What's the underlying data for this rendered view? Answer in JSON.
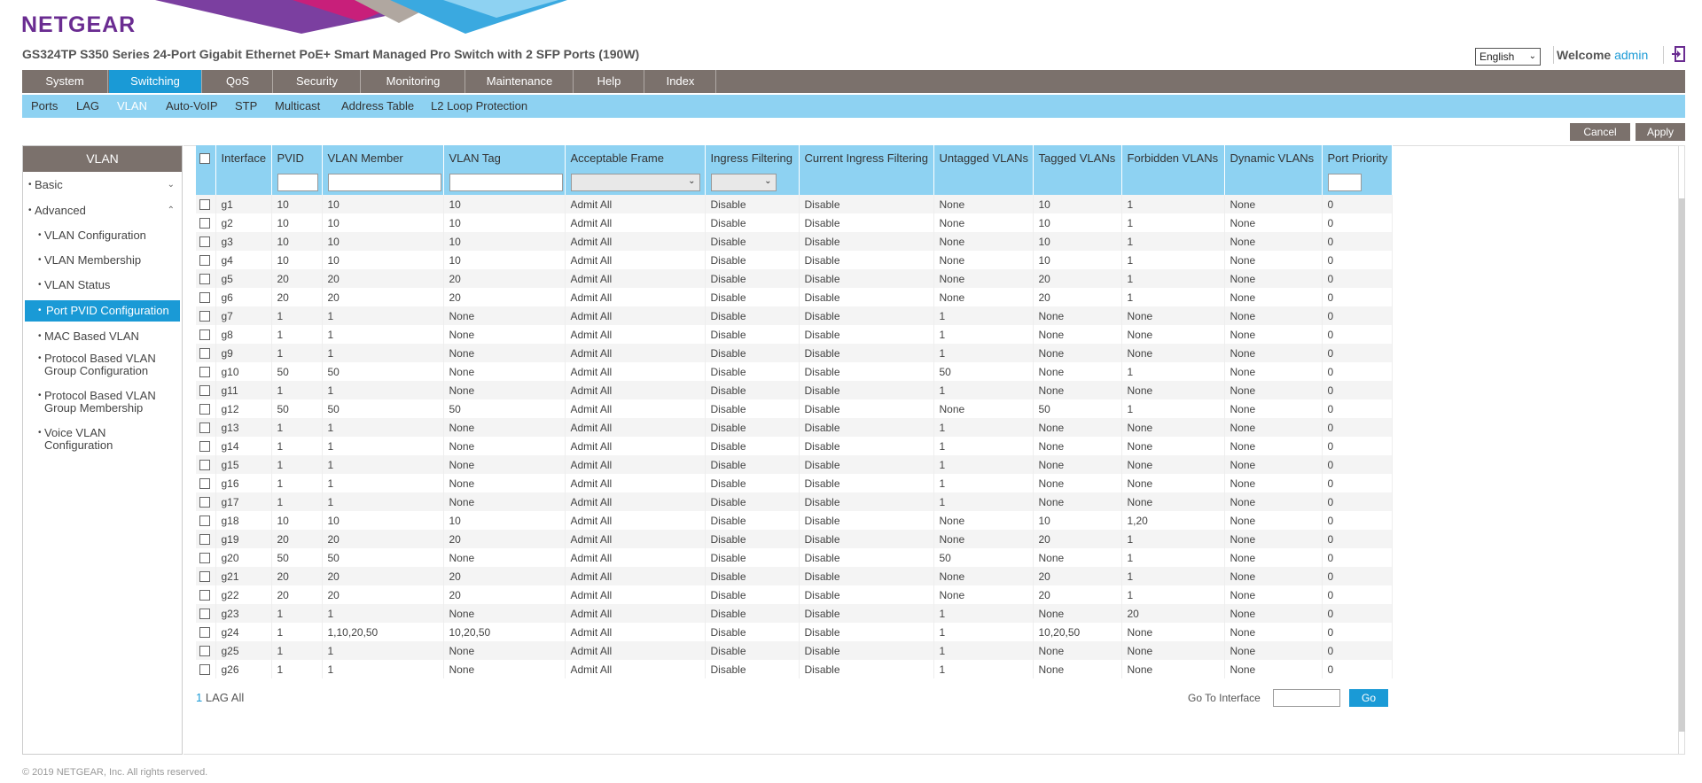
{
  "header": {
    "logo": "NETGEAR",
    "product_title": "GS324TP S350 Series 24-Port Gigabit Ethernet PoE+ Smart Managed Pro Switch with 2 SFP Ports (190W)",
    "language": "English",
    "welcome_label": "Welcome",
    "user": "admin"
  },
  "main_nav": [
    {
      "label": "System"
    },
    {
      "label": "Switching"
    },
    {
      "label": "QoS"
    },
    {
      "label": "Security"
    },
    {
      "label": "Monitoring"
    },
    {
      "label": "Maintenance"
    },
    {
      "label": "Help"
    },
    {
      "label": "Index"
    }
  ],
  "sub_nav": [
    {
      "label": "Ports"
    },
    {
      "label": "LAG"
    },
    {
      "label": "VLAN"
    },
    {
      "label": "Auto-VoIP"
    },
    {
      "label": "STP"
    },
    {
      "label": "Multicast"
    },
    {
      "label": "Address Table"
    },
    {
      "label": "L2 Loop Protection"
    }
  ],
  "actions": {
    "cancel": "Cancel",
    "apply": "Apply"
  },
  "sidebar": {
    "title": "VLAN",
    "items": [
      {
        "label": "Basic"
      },
      {
        "label": "Advanced"
      },
      {
        "label": "VLAN Configuration"
      },
      {
        "label": "VLAN Membership"
      },
      {
        "label": "VLAN Status"
      },
      {
        "label": "Port PVID Configuration"
      },
      {
        "label": "MAC Based VLAN"
      },
      {
        "label": "Protocol Based VLAN Group Configuration"
      },
      {
        "label": "Protocol Based VLAN Group Membership"
      },
      {
        "label": "Voice VLAN Configuration"
      }
    ]
  },
  "table": {
    "columns": [
      "Interface",
      "PVID",
      "VLAN Member",
      "VLAN Tag",
      "Acceptable Frame",
      "Ingress Filtering",
      "Current Ingress Filtering",
      "Untagged VLANs",
      "Tagged VLANs",
      "Forbidden VLANs",
      "Dynamic VLANs",
      "Port Priority"
    ],
    "rows": [
      [
        "g1",
        "10",
        "10",
        "10",
        "Admit All",
        "Disable",
        "Disable",
        "None",
        "10",
        "1",
        "None",
        "0"
      ],
      [
        "g2",
        "10",
        "10",
        "10",
        "Admit All",
        "Disable",
        "Disable",
        "None",
        "10",
        "1",
        "None",
        "0"
      ],
      [
        "g3",
        "10",
        "10",
        "10",
        "Admit All",
        "Disable",
        "Disable",
        "None",
        "10",
        "1",
        "None",
        "0"
      ],
      [
        "g4",
        "10",
        "10",
        "10",
        "Admit All",
        "Disable",
        "Disable",
        "None",
        "10",
        "1",
        "None",
        "0"
      ],
      [
        "g5",
        "20",
        "20",
        "20",
        "Admit All",
        "Disable",
        "Disable",
        "None",
        "20",
        "1",
        "None",
        "0"
      ],
      [
        "g6",
        "20",
        "20",
        "20",
        "Admit All",
        "Disable",
        "Disable",
        "None",
        "20",
        "1",
        "None",
        "0"
      ],
      [
        "g7",
        "1",
        "1",
        "None",
        "Admit All",
        "Disable",
        "Disable",
        "1",
        "None",
        "None",
        "None",
        "0"
      ],
      [
        "g8",
        "1",
        "1",
        "None",
        "Admit All",
        "Disable",
        "Disable",
        "1",
        "None",
        "None",
        "None",
        "0"
      ],
      [
        "g9",
        "1",
        "1",
        "None",
        "Admit All",
        "Disable",
        "Disable",
        "1",
        "None",
        "None",
        "None",
        "0"
      ],
      [
        "g10",
        "50",
        "50",
        "None",
        "Admit All",
        "Disable",
        "Disable",
        "50",
        "None",
        "1",
        "None",
        "0"
      ],
      [
        "g11",
        "1",
        "1",
        "None",
        "Admit All",
        "Disable",
        "Disable",
        "1",
        "None",
        "None",
        "None",
        "0"
      ],
      [
        "g12",
        "50",
        "50",
        "50",
        "Admit All",
        "Disable",
        "Disable",
        "None",
        "50",
        "1",
        "None",
        "0"
      ],
      [
        "g13",
        "1",
        "1",
        "None",
        "Admit All",
        "Disable",
        "Disable",
        "1",
        "None",
        "None",
        "None",
        "0"
      ],
      [
        "g14",
        "1",
        "1",
        "None",
        "Admit All",
        "Disable",
        "Disable",
        "1",
        "None",
        "None",
        "None",
        "0"
      ],
      [
        "g15",
        "1",
        "1",
        "None",
        "Admit All",
        "Disable",
        "Disable",
        "1",
        "None",
        "None",
        "None",
        "0"
      ],
      [
        "g16",
        "1",
        "1",
        "None",
        "Admit All",
        "Disable",
        "Disable",
        "1",
        "None",
        "None",
        "None",
        "0"
      ],
      [
        "g17",
        "1",
        "1",
        "None",
        "Admit All",
        "Disable",
        "Disable",
        "1",
        "None",
        "None",
        "None",
        "0"
      ],
      [
        "g18",
        "10",
        "10",
        "10",
        "Admit All",
        "Disable",
        "Disable",
        "None",
        "10",
        "1,20",
        "None",
        "0"
      ],
      [
        "g19",
        "20",
        "20",
        "20",
        "Admit All",
        "Disable",
        "Disable",
        "None",
        "20",
        "1",
        "None",
        "0"
      ],
      [
        "g20",
        "50",
        "50",
        "None",
        "Admit All",
        "Disable",
        "Disable",
        "50",
        "None",
        "1",
        "None",
        "0"
      ],
      [
        "g21",
        "20",
        "20",
        "20",
        "Admit All",
        "Disable",
        "Disable",
        "None",
        "20",
        "1",
        "None",
        "0"
      ],
      [
        "g22",
        "20",
        "20",
        "20",
        "Admit All",
        "Disable",
        "Disable",
        "None",
        "20",
        "1",
        "None",
        "0"
      ],
      [
        "g23",
        "1",
        "1",
        "None",
        "Admit All",
        "Disable",
        "Disable",
        "1",
        "None",
        "20",
        "None",
        "0"
      ],
      [
        "g24",
        "1",
        "1,10,20,50",
        "10,20,50",
        "Admit All",
        "Disable",
        "Disable",
        "1",
        "10,20,50",
        "None",
        "None",
        "0"
      ],
      [
        "g25",
        "1",
        "1",
        "None",
        "Admit All",
        "Disable",
        "Disable",
        "1",
        "None",
        "None",
        "None",
        "0"
      ],
      [
        "g26",
        "1",
        "1",
        "None",
        "Admit All",
        "Disable",
        "Disable",
        "1",
        "None",
        "None",
        "None",
        "0"
      ]
    ]
  },
  "pager": {
    "page": "1",
    "lag": "LAG",
    "all": "All"
  },
  "goto": {
    "label": "Go To Interface",
    "button": "Go"
  },
  "footer": {
    "copyright": "© 2019 NETGEAR, Inc. All rights reserved."
  },
  "colors": {
    "brand": "#6a2c91",
    "accent": "#1a9ad6",
    "nav_bg": "#7b716c",
    "sub_nav_bg": "#8ed2f2"
  }
}
